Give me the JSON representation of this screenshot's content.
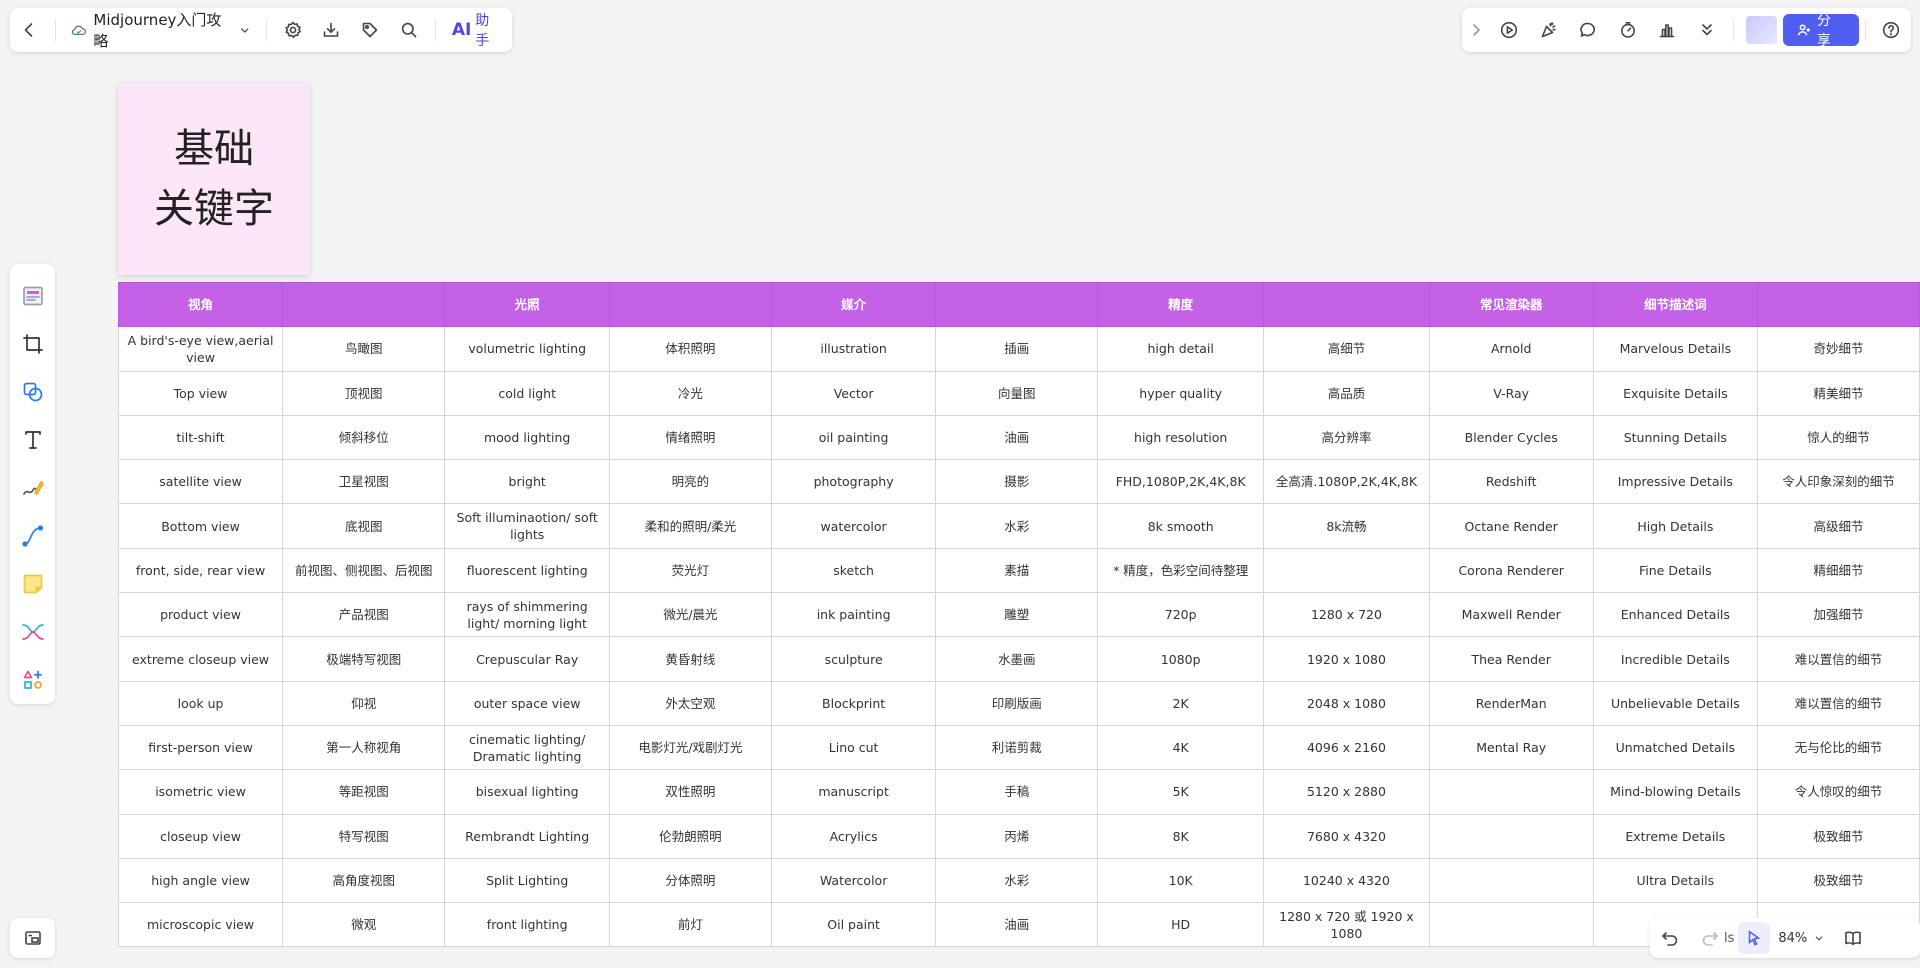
{
  "toolbar_left": {
    "doc_title": "Midjourney入门攻略",
    "ai_label": "AI",
    "ai_sub": "助手"
  },
  "toolbar_right": {
    "share_label": "分享"
  },
  "zoom": {
    "level": "84%",
    "partial_text": "ls"
  },
  "sticky": {
    "line1": "基础",
    "line2": "关键字"
  },
  "table": {
    "headers": [
      "视角",
      "",
      "光照",
      "",
      "媒介",
      "",
      "精度",
      "",
      "常见渲染器",
      "细节描述词",
      ""
    ],
    "rows": [
      [
        "A bird's-eye view,aerial view",
        "鸟瞰图",
        "volumetric lighting",
        "体积照明",
        "illustration",
        "插画",
        "high detail",
        "高细节",
        "Arnold",
        "Marvelous Details",
        "奇妙细节"
      ],
      [
        "Top view",
        "顶视图",
        "cold light",
        "冷光",
        "Vector",
        "向量图",
        "hyper quality",
        "高品质",
        "V-Ray",
        "Exquisite Details",
        "精美细节"
      ],
      [
        "tilt-shift",
        "倾斜移位",
        "mood lighting",
        "情绪照明",
        "oil painting",
        "油画",
        "high resolution",
        "高分辨率",
        "Blender Cycles",
        "Stunning Details",
        "惊人的细节"
      ],
      [
        "satellite view",
        "卫星视图",
        "bright",
        "明亮的",
        "photography",
        "摄影",
        "FHD,1080P,2K,4K,8K",
        "全高清.1080P,2K,4K,8K",
        "Redshift",
        "Impressive Details",
        "令人印象深刻的细节"
      ],
      [
        "Bottom view",
        "底视图",
        "Soft illuminaotion/ soft lights",
        "柔和的照明/柔光",
        "watercolor",
        "水彩",
        "8k smooth",
        "8k流畅",
        "Octane Render",
        "High Details",
        "高级细节"
      ],
      [
        "front, side, rear view",
        "前视图、侧视图、后视图",
        "fluorescent lighting",
        "荧光灯",
        "sketch",
        "素描",
        "* 精度，色彩空间待整理",
        "",
        "Corona Renderer",
        "Fine Details",
        "精细细节"
      ],
      [
        "product view",
        "产品视图",
        "rays of shimmering light/ morning light",
        "微光/晨光",
        "ink painting",
        "雕塑",
        "720p",
        "1280 x 720",
        "Maxwell Render",
        "Enhanced Details",
        "加强细节"
      ],
      [
        "extreme closeup view",
        "极端特写视图",
        "Crepuscular Ray",
        "黄昏射线",
        "sculpture",
        "水墨画",
        "1080p",
        "1920 x 1080",
        "Thea Render",
        "Incredible Details",
        "难以置信的细节"
      ],
      [
        "look up",
        "仰视",
        "outer space view",
        "外太空观",
        "Blockprint",
        "印刷版画",
        "2K",
        "2048 x 1080",
        "RenderMan",
        "Unbelievable Details",
        "难以置信的细节"
      ],
      [
        "first-person view",
        "第一人称视角",
        "cinematic lighting/ Dramatic lighting",
        "电影灯光/戏剧灯光",
        "Lino cut",
        "利诺剪裁",
        "4K",
        "4096 x 2160",
        "Mental Ray",
        "Unmatched Details",
        "无与伦比的细节"
      ],
      [
        "isometric view",
        "等距视图",
        "bisexual lighting",
        "双性照明",
        "manuscript",
        "手稿",
        "5K",
        "5120 x 2880",
        "",
        "Mind-blowing Details",
        "令人惊叹的细节"
      ],
      [
        "closeup view",
        "特写视图",
        "Rembrandt Lighting",
        "伦勃朗照明",
        "Acrylics",
        "丙烯",
        "8K",
        "7680 x 4320",
        "",
        "Extreme Details",
        "极致细节"
      ],
      [
        "high angle view",
        "高角度视图",
        "Split Lighting",
        "分体照明",
        "Watercolor",
        "水彩",
        "10K",
        "10240 x 4320",
        "",
        "Ultra Details",
        "极致细节"
      ],
      [
        "microscopic view",
        "微观",
        "front lighting",
        "前灯",
        "Oil paint",
        "油画",
        "HD",
        "1280 x 720 或 1920 x 1080",
        "",
        "",
        ""
      ]
    ]
  },
  "colors": {
    "header_bg": "#c561e6",
    "accent": "#4f5df0",
    "sticky_bg": "#fde6f8"
  },
  "icons": {
    "left_toolbar": [
      "back-icon",
      "cloud-sync-icon",
      "chevron-down-icon",
      "settings-icon",
      "download-icon",
      "tag-icon",
      "search-icon"
    ],
    "right_toolbar": [
      "chevron-right-icon",
      "play-icon",
      "celebrate-icon",
      "comment-icon",
      "timer-icon",
      "chart-icon",
      "double-chevron-down-icon",
      "share-user-icon",
      "help-icon"
    ],
    "left_tools": [
      "frame-template-icon",
      "crop-frame-icon",
      "shape-icon",
      "text-icon",
      "pen-icon",
      "connector-icon",
      "sticky-note-icon",
      "mindmap-icon",
      "more-shapes-icon"
    ],
    "bottom": [
      "minimap-icon",
      "undo-icon",
      "redo-icon",
      "select-cursor-icon",
      "book-icon"
    ]
  }
}
